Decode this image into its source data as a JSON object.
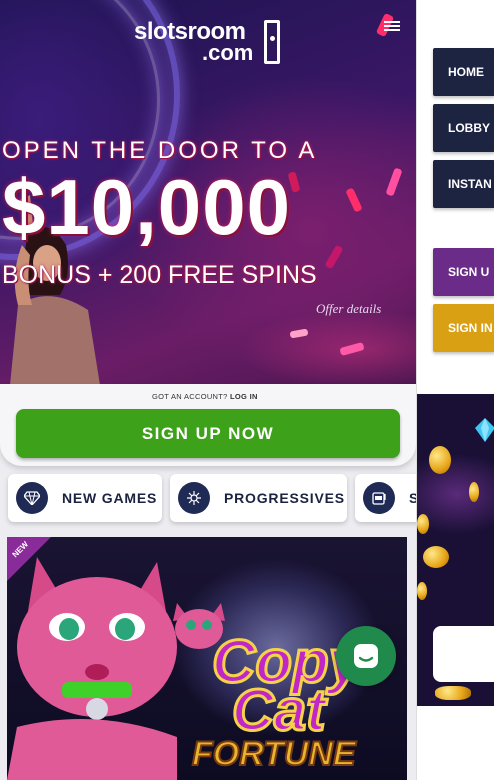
{
  "header": {
    "logo_line1": "slotsroom",
    "logo_line2": ".com"
  },
  "hero": {
    "line1": "OPEN THE DOOR TO A",
    "line2": "$10,000",
    "line3": "BONUS + 200 FREE SPINS",
    "offer_link": "Offer details"
  },
  "account": {
    "prompt": "GOT AN ACCOUNT?",
    "login": "LOG IN",
    "cta": "SIGN UP NOW"
  },
  "categories": [
    {
      "label": "NEW GAMES",
      "icon": "diamond-icon"
    },
    {
      "label": "PROGRESSIVES",
      "icon": "sparkle-icon"
    },
    {
      "label": "S",
      "icon": "slot-machine-icon"
    }
  ],
  "game": {
    "ribbon": "NEW",
    "title_line1": "Copy",
    "title_line2": "Cat",
    "title_line3": "FORTUNE"
  },
  "drawer": {
    "nav": [
      "HOME",
      "LOBBY",
      "INSTAN"
    ],
    "signup": "SIGN U",
    "signin": "SIGN IN"
  },
  "colors": {
    "cta_green": "#3ea11a",
    "nav_navy": "#1d2442",
    "signup_purple": "#6b2b88",
    "signin_gold": "#d9a013",
    "chat_green": "#1f8a4c"
  }
}
